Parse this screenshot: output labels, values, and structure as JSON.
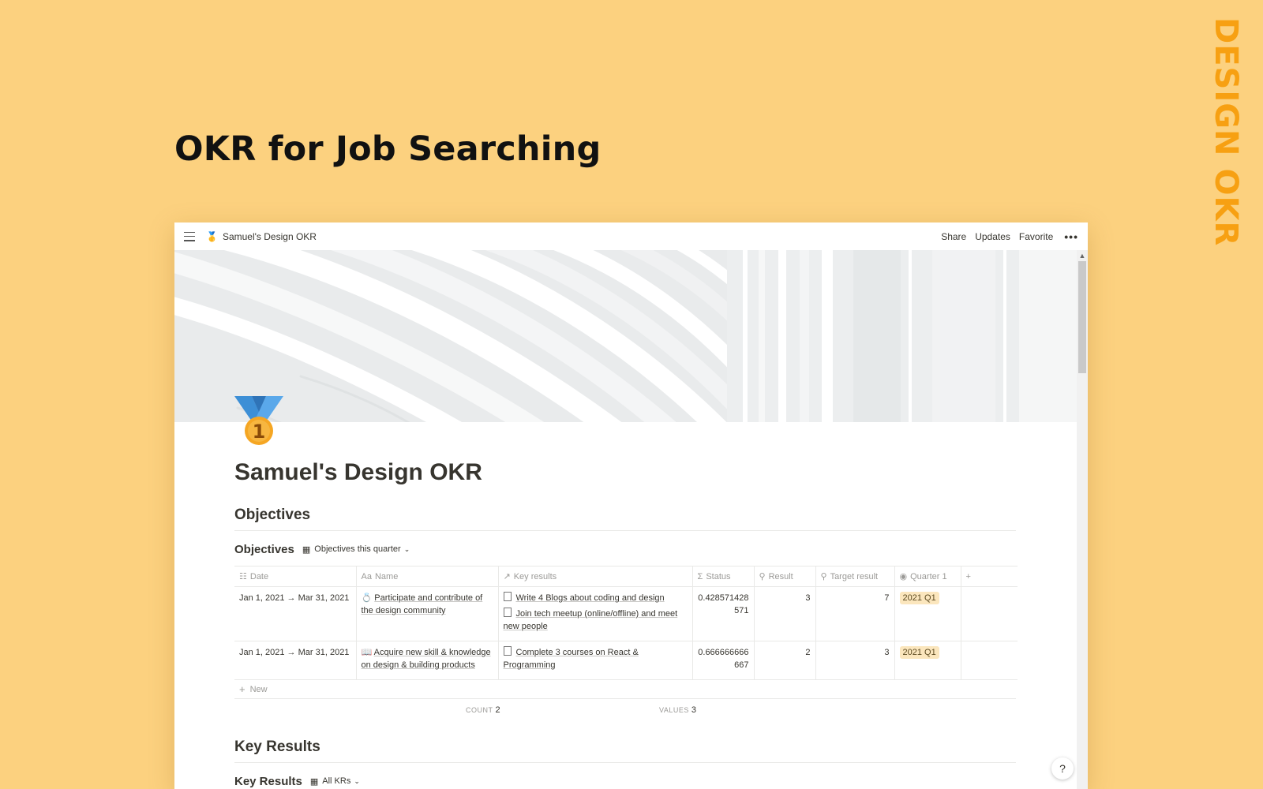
{
  "hero": {
    "title": "OKR for Job Searching",
    "side_label": "DESIGN OKR"
  },
  "topbar": {
    "breadcrumb_icon": "medal-icon",
    "breadcrumb": "Samuel's Design OKR",
    "actions": {
      "share": "Share",
      "updates": "Updates",
      "favorite": "Favorite",
      "more": "•••"
    }
  },
  "page": {
    "icon": "1st-place-medal-icon",
    "title": "Samuel's Design OKR",
    "objectives_heading": "Objectives",
    "key_results_heading": "Key Results"
  },
  "objectives_db": {
    "title": "Objectives",
    "view": "Objectives this quarter",
    "columns": {
      "date": "Date",
      "name": "Name",
      "key_results": "Key results",
      "status": "Status",
      "result": "Result",
      "target": "Target result",
      "quarter": "Quarter 1"
    },
    "rows": [
      {
        "date": "Jan 1, 2021 → Mar 31, 2021",
        "name_icon": "ring-icon",
        "name": "Participate and contribute of the design community",
        "kr1": "Write 4 Blogs about coding and design",
        "kr2": "Join tech meetup (online/offline) and meet new people",
        "status": "0.428571428571",
        "result": "3",
        "target": "7",
        "quarter": "2021 Q1"
      },
      {
        "date": "Jan 1, 2021 → Mar 31, 2021",
        "name_icon": "book-icon",
        "name": "Acquire new skill & knowledge on design & building products",
        "kr1": "Complete 3 courses on React & Programming",
        "status": "0.666666666667",
        "result": "2",
        "target": "3",
        "quarter": "2021 Q1"
      }
    ],
    "new_label": "New",
    "calc": {
      "count_label": "COUNT",
      "count": "2",
      "values_label": "VALUES",
      "values": "3"
    }
  },
  "key_results_db": {
    "title": "Key Results",
    "view": "All KRs"
  },
  "help": "?",
  "colors": {
    "background": "#fcd17f",
    "side_label": "#f7a012",
    "tag_bg": "#fbe6bd"
  }
}
